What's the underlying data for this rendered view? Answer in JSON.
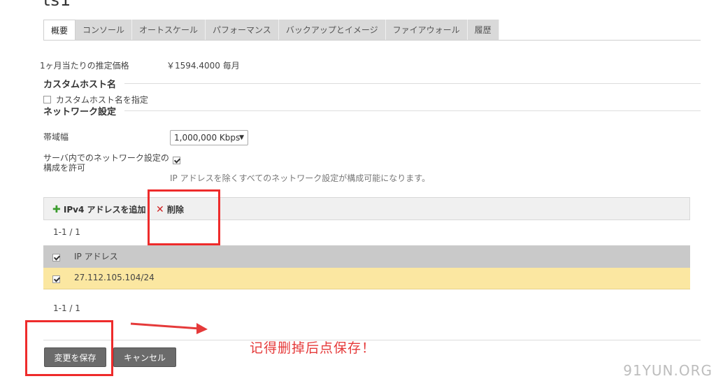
{
  "header": {
    "title": "ts1"
  },
  "tabs": [
    {
      "label": "概要",
      "active": true
    },
    {
      "label": "コンソール"
    },
    {
      "label": "オートスケール"
    },
    {
      "label": "パフォーマンス"
    },
    {
      "label": "バックアップとイメージ"
    },
    {
      "label": "ファイアウォール"
    },
    {
      "label": "履歴"
    }
  ],
  "pricing": {
    "label": "1ヶ月当たりの推定価格",
    "value": "￥1594.4000 毎月"
  },
  "custom_host": {
    "section_title": "カスタムホスト名",
    "checkbox_label": "カスタムホスト名を指定",
    "checked": false
  },
  "network": {
    "section_title": "ネットワーク設定",
    "bandwidth_label": "帯域幅",
    "bandwidth_value": "1,000,000 Kbps",
    "allow_label": "サーバ内でのネットワーク設定の構成を許可",
    "allow_checked": true,
    "allow_hint": "IP アドレスを除くすべてのネットワーク設定が構成可能になります。"
  },
  "ip_toolbar": {
    "add_label": "IPv4 アドレスを追加",
    "delete_label": "削除"
  },
  "ip_table": {
    "pager_top": "1-1 / 1",
    "column_header": "IP アドレス",
    "rows": [
      {
        "ip": "27.112.105.104/24",
        "checked": true
      }
    ],
    "pager_bottom": "1-1 / 1"
  },
  "actions": {
    "save_label": "変更を保存",
    "cancel_label": "キャンセル"
  },
  "annotation": {
    "text": "记得删掉后点保存！",
    "color": "#e53a3a"
  },
  "watermark": "91YUN.ORG"
}
